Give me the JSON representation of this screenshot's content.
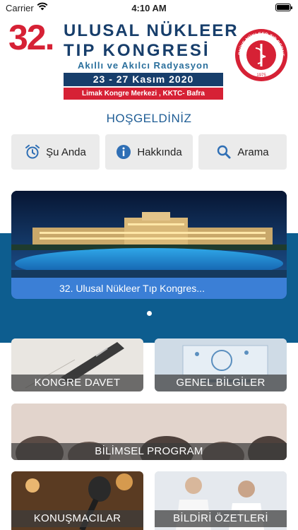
{
  "status_bar": {
    "carrier": "Carrier",
    "time": "4:10 AM",
    "battery_level": 1.0
  },
  "header": {
    "congress_number": "32.",
    "title_line1": "ULUSAL NÜKLEER",
    "title_line2": "TIP KONGRESİ",
    "theme": "Akıllı ve Akılcı Radyasyon",
    "dates": "23 - 27 Kasım 2020",
    "venue": "Limak Kongre Merkezi , KKTC- Bafra",
    "society_logo": {
      "top_text": "TÜRKİYE NÜKLEER TIP DERNEĞİ",
      "year": "1975"
    }
  },
  "welcome": "HOŞGELDİNİZ",
  "quick_actions": [
    {
      "label": "Şu Anda",
      "icon": "alarm-clock-icon"
    },
    {
      "label": "Hakkında",
      "icon": "info-icon"
    },
    {
      "label": "Arama",
      "icon": "search-icon"
    }
  ],
  "carousel": {
    "caption": "32. Ulusal Nükleer Tıp Kongres...",
    "page_count": 1,
    "current_page": 1
  },
  "tiles": [
    {
      "label": "KONGRE DAVET"
    },
    {
      "label": "GENEL BİLGİLER"
    },
    {
      "label": "BİLİMSEL PROGRAM"
    },
    {
      "label": "KONUŞMACILAR"
    },
    {
      "label": "BİLDİRİ ÖZETLERİ"
    }
  ],
  "colors": {
    "brand_red": "#d62135",
    "brand_navy": "#173e6b",
    "carousel_band": "#0d5d8f",
    "caption_blue": "#3b7fd6",
    "icon_blue": "#2f6fb5"
  }
}
